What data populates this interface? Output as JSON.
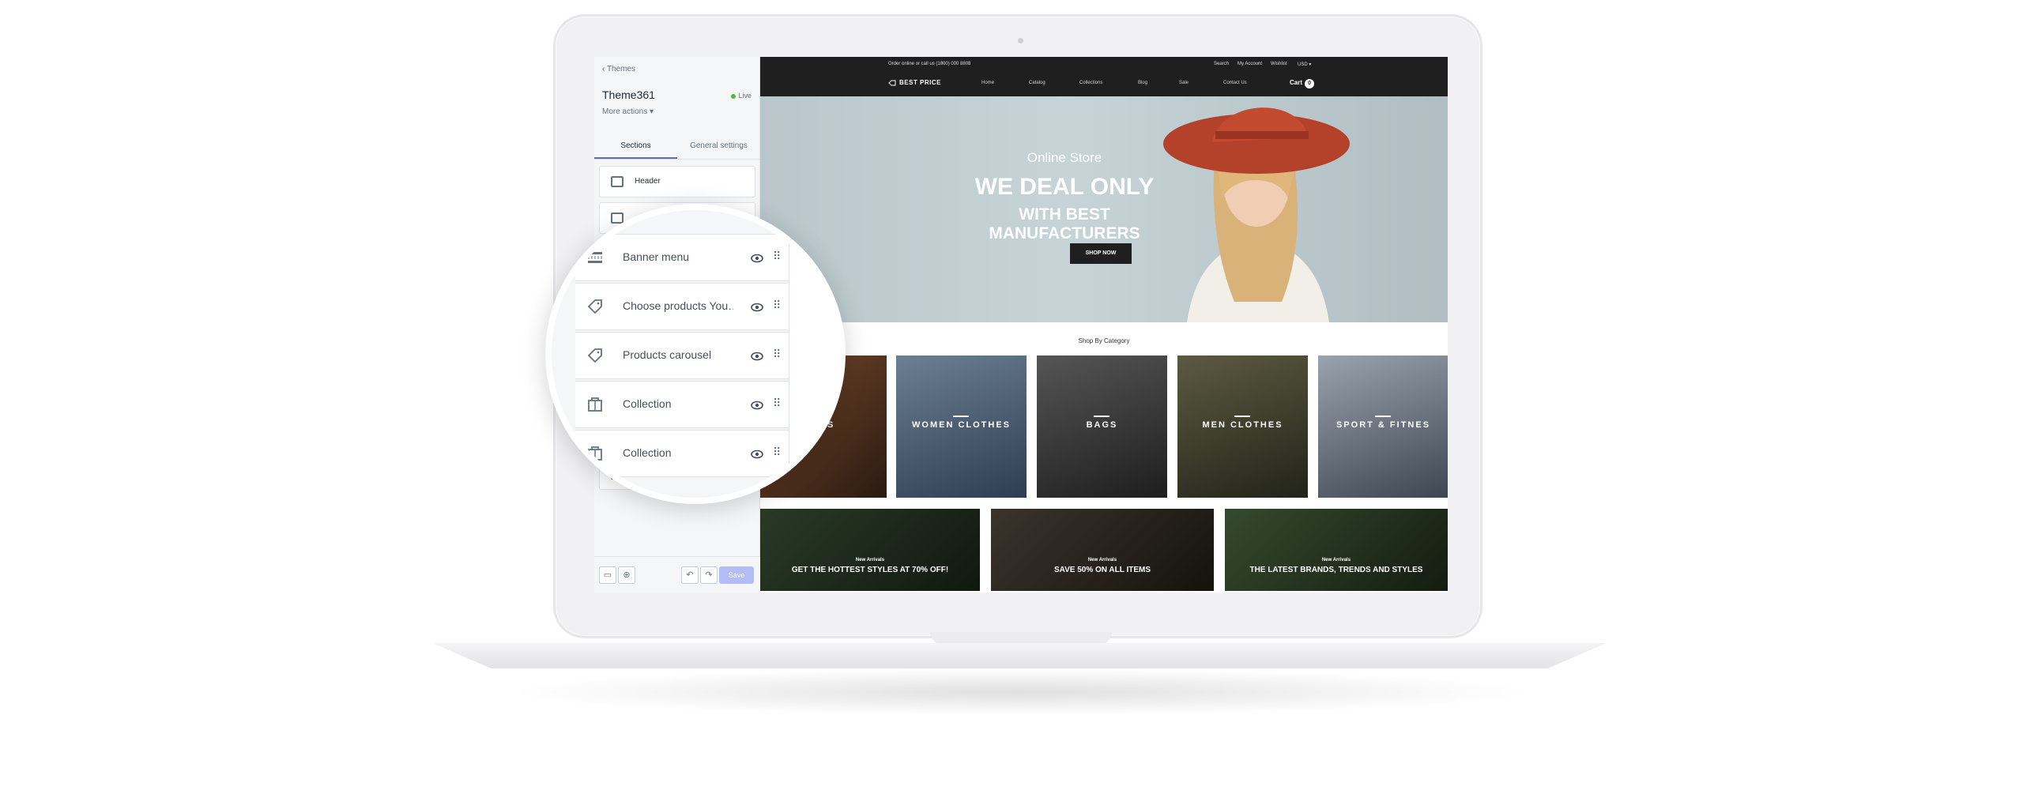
{
  "editor": {
    "back_label": "Themes",
    "theme_name": "Theme361",
    "status": "Live",
    "more_actions": "More actions",
    "tabs": [
      {
        "label": "Sections",
        "active": true
      },
      {
        "label": "General settings",
        "active": false
      }
    ],
    "sections": [
      {
        "label": "Header",
        "icon": "header-layout-icon"
      },
      {
        "label": "",
        "icon": "slideshow-icon"
      }
    ],
    "save_label": "Save"
  },
  "magnifier": {
    "rows": [
      {
        "label": "Banner menu",
        "icon": "banner-menu-icon"
      },
      {
        "label": "Choose products You…",
        "icon": "tag-icon"
      },
      {
        "label": "Products carousel",
        "icon": "tag-icon"
      },
      {
        "label": "Collection",
        "icon": "collection-icon"
      },
      {
        "label": "Collection",
        "icon": "collection-icon"
      }
    ]
  },
  "store": {
    "topbar_phone": "Order online or call us (1800) 000 8808",
    "topbar_links": [
      "Search",
      "My Account",
      "Wishlist",
      "USD"
    ],
    "logo": "BEST PRICE",
    "nav": [
      "Home",
      "Catalog",
      "Collections",
      "Blog",
      "Sale",
      "Contact Us"
    ],
    "cart_label": "Cart",
    "cart_count": "0",
    "hero": {
      "kicker": "Online Store",
      "headline": "WE DEAL ONLY",
      "subheadline": "WITH BEST MANUFACTURERS",
      "button": "SHOP NOW"
    },
    "category_title": "Shop By Category",
    "categories": [
      "DES",
      "WOMEN CLOTHES",
      "BAGS",
      "MEN CLOTHES",
      "SPORT & FITNES"
    ],
    "promos": [
      {
        "kicker": "New Arrivals",
        "text": "GET THE HOTTEST STYLES AT 70% OFF!"
      },
      {
        "kicker": "New Arrivals",
        "text": "SAVE 50% ON ALL ITEMS"
      },
      {
        "kicker": "New Arrivals",
        "text": "THE LATEST BRANDS, TRENDS AND STYLES"
      }
    ]
  },
  "colors": {
    "accent": "#5c6ac4",
    "live": "#50b83c",
    "store_dark": "#1f1f1f"
  }
}
